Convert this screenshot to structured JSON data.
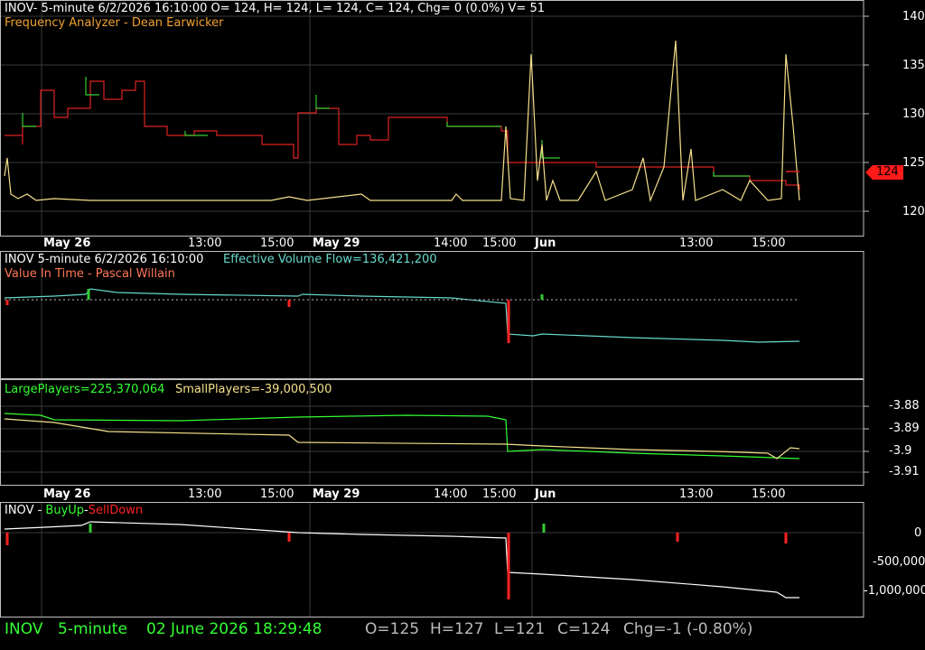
{
  "colors": {
    "grid": "#3a3a3a",
    "border": "#c0c0c0",
    "yellow": "#f5e08a",
    "orange": "#f0a030",
    "cyan": "#66d9cc",
    "lime": "#33ff33",
    "red": "#ff2222",
    "green_bar": "#33cc33",
    "white": "#ffffff",
    "price_badge": "#ff1a1a"
  },
  "price_panel": {
    "header": "INOV- 5-minute 6/2/2026 16:10:00 O= 124, H= 124, L= 124, C= 124, Chg= 0 (0.0%) V= 51",
    "indicator": "Frequency Analyzer - Dean Earwicker",
    "y_ticks": [
      "140",
      "135",
      "130",
      "125",
      "120"
    ],
    "last_price": "124"
  },
  "time_axis": {
    "labels": [
      {
        "text": "May 26",
        "bold": true
      },
      {
        "text": "13:00",
        "bold": false
      },
      {
        "text": "15:00",
        "bold": false
      },
      {
        "text": "May 29",
        "bold": true
      },
      {
        "text": "14:00",
        "bold": false
      },
      {
        "text": "15:00",
        "bold": false
      },
      {
        "text": "Jun",
        "bold": true
      },
      {
        "text": "13:00",
        "bold": false
      },
      {
        "text": "15:00",
        "bold": false
      }
    ]
  },
  "volume_panel": {
    "header_symbol": "INOV 5-minute  6/2/2026 16:10:00",
    "header_evf": "Effective Volume Flow=136,421,200",
    "indicator": "Value In Time - Pascal Willain"
  },
  "players_panel": {
    "large": "LargePlayers=225,370,064",
    "small": "SmallPlayers=-39,000,500",
    "y_ticks": [
      "-3.88",
      "-3.89",
      "-3.9",
      "-3.91"
    ]
  },
  "buyup_panel": {
    "symbol": "INOV - ",
    "buy": "BuyUp",
    "sep": "-",
    "sell": "SellDown",
    "y_ticks": [
      "0",
      "-500,000",
      "-1,000,000"
    ]
  },
  "status_bar": {
    "symbol": "INOV",
    "interval": "5-minute",
    "datetime": "02 June 2026 18:29:48",
    "open": "O=125",
    "high": "H=127",
    "low": "L=121",
    "close": "C=124",
    "change": "Chg=-1 (-0.80%)"
  }
}
